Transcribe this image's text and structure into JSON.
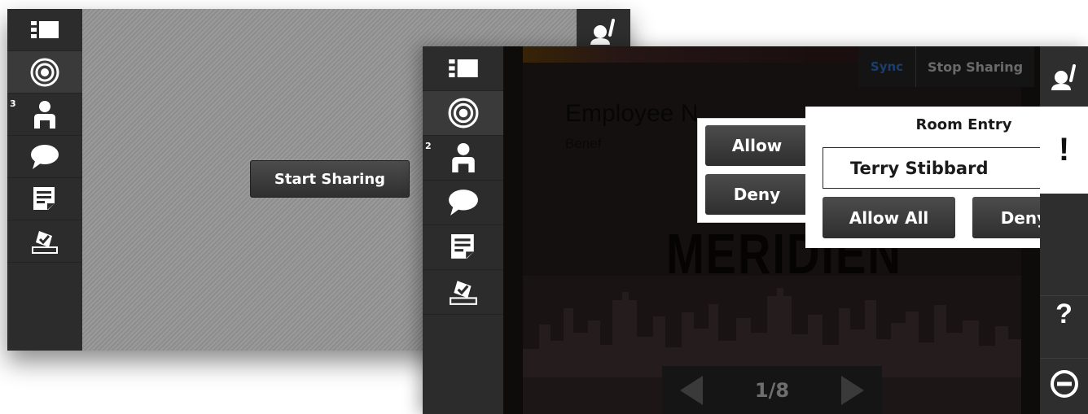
{
  "back_screen": {
    "sidebar": [
      {
        "name": "layout-icon",
        "badge": ""
      },
      {
        "name": "target-icon",
        "badge": "",
        "active": true
      },
      {
        "name": "attendees-icon",
        "badge": "3"
      },
      {
        "name": "chat-icon",
        "badge": ""
      },
      {
        "name": "notes-icon",
        "badge": ""
      },
      {
        "name": "poll-icon",
        "badge": ""
      }
    ],
    "start_sharing_label": "Start Sharing",
    "right_icon": "raise-hand-icon"
  },
  "front_screen": {
    "sidebar": [
      {
        "name": "layout-icon",
        "badge": ""
      },
      {
        "name": "target-icon",
        "badge": "",
        "active": true
      },
      {
        "name": "attendees-icon",
        "badge": "2"
      },
      {
        "name": "chat-icon",
        "badge": ""
      },
      {
        "name": "notes-icon",
        "badge": ""
      },
      {
        "name": "poll-icon",
        "badge": ""
      }
    ],
    "toolbar": {
      "sync_label": "Sync",
      "stop_label": "Stop Sharing",
      "sync_color": "#1b3f6c"
    },
    "slide": {
      "title": "Employee N",
      "subtitle": "Benef",
      "logo_text": "MERIDIEN"
    },
    "pager": {
      "page_text": "1/8"
    },
    "room_entry": {
      "title": "Room Entry",
      "name": "Terry Stibbard",
      "allow_label": "Allow",
      "deny_label": "Deny",
      "allow_all_label": "Allow All",
      "deny_all_label": "Deny All"
    },
    "right_bar": {
      "alert_text": "!",
      "help_text": "?",
      "top_icon": "raise-hand-icon",
      "bottom_icon": "leave-icon"
    }
  }
}
